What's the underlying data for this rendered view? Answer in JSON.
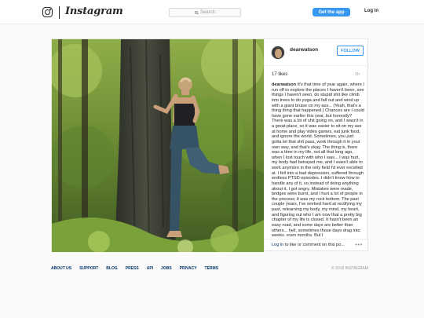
{
  "header": {
    "wordmark": "Instagram",
    "search_placeholder": "Search",
    "get_app_label": "Get the app",
    "login_label": "Log in"
  },
  "post": {
    "username": "dearwatson",
    "follow_label": "FOLLOW",
    "likes": "17 likes",
    "time": "1h",
    "caption_username": "dearwatson",
    "caption": "It's that time of year again, where I run off to explore the places I haven't been, see things I haven't seen, do stupid shit like climb into trees to do yoga and fall out and wind up with a giant bruise on my ass... (Yeah, that's a thing thing that happened.) Chances are I could have gone earlier this year, but honestly? There was a lot of shit going on, and I wasn't in a great place, so it was easier to sit on my ass at home and play video games, eat junk food, and ignore the world. Sometimes, you just gotta let that shit pass, work through it in your own way, and that's okay. The thing is, there was a time in my life, not all that long ago, when I lost touch with who I was... I was hurt, my body had betrayed me, and I wasn't able to work anymore in the only field I'd ever excelled at. I fell into a bad depression, suffered through endless PTSD episodes. I didn't know how to handle any of it, so instead of doing anything about it, I got angry. Mistakes were made, bridges were burnt, and I hurt a lot of people in the process; it was my rock bottom. The past couple years, I've worked hard at rectifying my past, relearning my body, my mind, my heart, and figuring out who I am now that a pretty big chapter of my life is closed. It hasn't been an easy road, and some days are better than others... hell, sometimes those days drag into weeks, even months. But I",
    "login_link": "Log in",
    "login_rest": " to like or comment on this po...",
    "more_label": "•••"
  },
  "footer": {
    "links": [
      "ABOUT US",
      "SUPPORT",
      "BLOG",
      "PRESS",
      "API",
      "JOBS",
      "PRIVACY",
      "TERMS"
    ],
    "copyright": "© 2018 INSTAGRAM"
  }
}
